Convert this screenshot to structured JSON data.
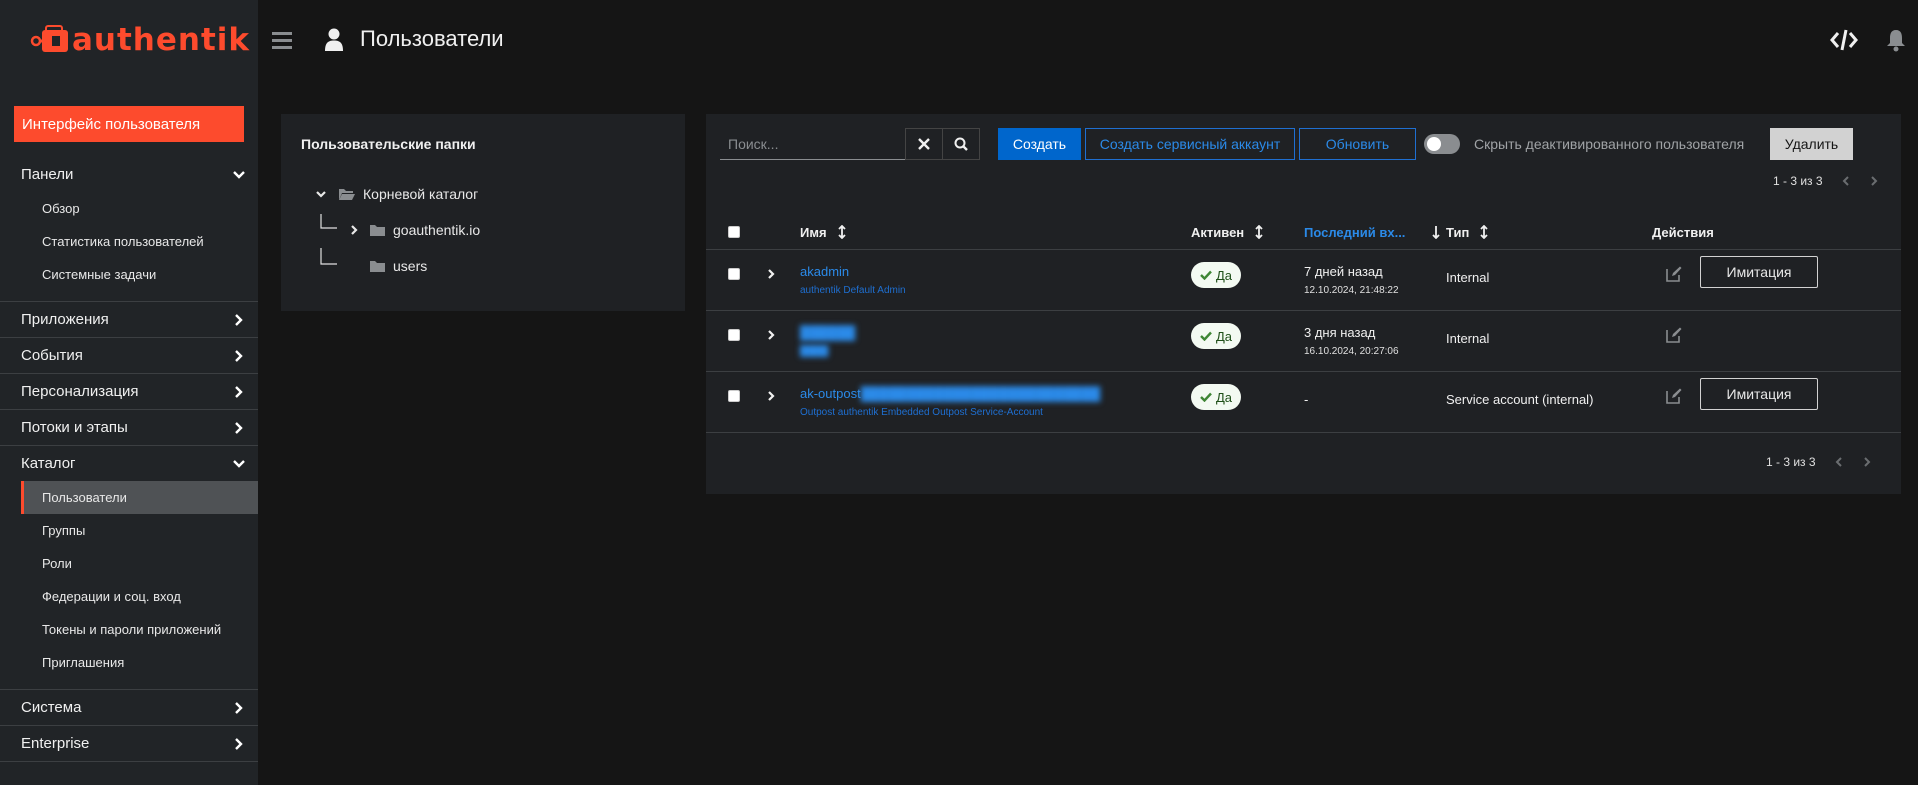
{
  "brand": {
    "name": "authentik",
    "color": "#fd4b2d"
  },
  "sidebar": {
    "user_interface_btn": "Интерфейс пользователя",
    "groups": [
      {
        "label": "Панели",
        "expanded": true,
        "items": [
          "Обзор",
          "Статистика пользователей",
          "Системные задачи"
        ]
      },
      {
        "label": "Приложения",
        "expanded": false
      },
      {
        "label": "События",
        "expanded": false
      },
      {
        "label": "Персонализация",
        "expanded": false
      },
      {
        "label": "Потоки и этапы",
        "expanded": false
      },
      {
        "label": "Каталог",
        "expanded": true,
        "items": [
          "Пользователи",
          "Группы",
          "Роли",
          "Федерации и соц. вход",
          "Токены и пароли приложений",
          "Приглашения"
        ],
        "active_item": "Пользователи"
      },
      {
        "label": "Система",
        "expanded": false
      },
      {
        "label": "Enterprise",
        "expanded": false
      }
    ]
  },
  "header": {
    "title": "Пользователи"
  },
  "folders": {
    "title": "Пользовательские папки",
    "root": "Корневой каталог",
    "children": [
      "goauthentik.io",
      "users"
    ]
  },
  "toolbar": {
    "search_placeholder": "Поиск...",
    "create": "Создать",
    "create_service": "Создать сервисный аккаунт",
    "refresh": "Обновить",
    "hide_deactivated": "Скрыть деактивированного пользователя",
    "delete": "Удалить"
  },
  "pagination": {
    "top": "1 - 3 из 3",
    "bottom": "1 - 3 из 3"
  },
  "table": {
    "columns": {
      "name": "Имя",
      "active": "Активен",
      "last_login": "Последний вх...",
      "type": "Тип",
      "actions": "Действия"
    },
    "rows": [
      {
        "username": "akadmin",
        "display_name": "authentik Default Admin",
        "active": "Да",
        "last_login": "7 дней назад",
        "last_login_exact": "12.10.2024, 21:48:22",
        "type": "Internal",
        "impersonate": "Имитация"
      },
      {
        "username": "██████",
        "display_name": "████",
        "active": "Да",
        "last_login": "3 дня назад",
        "last_login_exact": "16.10.2024, 20:27:06",
        "type": "Internal",
        "impersonate": ""
      },
      {
        "username": "ak-outpost",
        "username_hidden": "██████████████████████████",
        "display_name": "Outpost authentik Embedded Outpost Service-Account",
        "active": "Да",
        "last_login": "-",
        "last_login_exact": "",
        "type": "Service account (internal)",
        "impersonate": "Имитация"
      }
    ]
  }
}
